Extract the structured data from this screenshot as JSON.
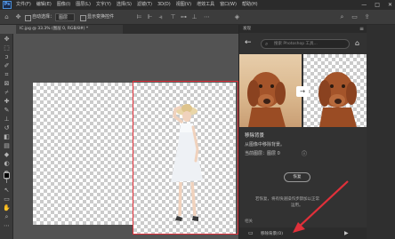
{
  "menubar": {
    "logo": "Ps",
    "menus": [
      "文件(F)",
      "编辑(E)",
      "图像(I)",
      "图层(L)",
      "文字(Y)",
      "选择(S)",
      "滤镜(T)",
      "3D(D)",
      "视图(V)",
      "增效工具",
      "窗口(W)",
      "帮助(H)"
    ],
    "window_controls": [
      "—",
      "□",
      "✕"
    ]
  },
  "options": {
    "auto_select_label": "自动选择：",
    "auto_select_value": "图层",
    "transform_label": "显示变换控件"
  },
  "document": {
    "tab_title": "IC.jpg @ 33.3% (图层 0, RGB/8#) *"
  },
  "panel": {
    "header_label": "发现",
    "search_placeholder": "搜索 Photoshop 工具...",
    "heading": "移除背景",
    "desc": "从图像中移除背景。",
    "current_layer": "当前图层：图层 0",
    "start_button": "恢复",
    "info_line1": "若恢复，将有快速操作步骤加以正常",
    "info_line2": "运用。",
    "section_label": "相关",
    "link_label": "移除背景(O)"
  },
  "colors": {
    "accent": "#e0303a",
    "panel_bg": "#323232",
    "workspace": "#535353"
  }
}
